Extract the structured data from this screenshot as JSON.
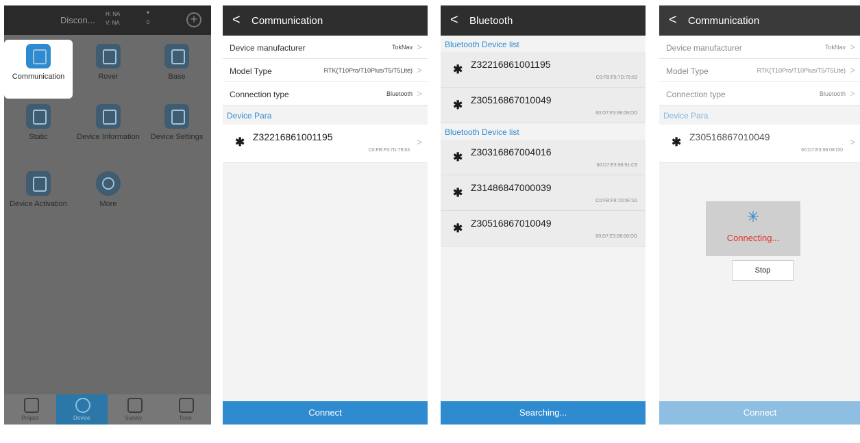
{
  "home": {
    "status": {
      "conn": "Discon...",
      "h": "H: NA",
      "v": "V: NA",
      "sats": "0"
    },
    "grid": [
      {
        "label": "Communication",
        "icon": "communication-icon"
      },
      {
        "label": "Rover",
        "icon": "rover-icon"
      },
      {
        "label": "Base",
        "icon": "base-icon"
      },
      {
        "label": "Static",
        "icon": "static-icon"
      },
      {
        "label": "Device Information",
        "icon": "device-info-icon"
      },
      {
        "label": "Device Settings",
        "icon": "device-settings-icon"
      },
      {
        "label": "Device Activation",
        "icon": "device-activation-icon"
      },
      {
        "label": "More",
        "icon": "more-icon"
      }
    ],
    "nav": [
      "Project",
      "Device",
      "Survey",
      "Tools"
    ]
  },
  "comm": {
    "title": "Communication",
    "rows": [
      {
        "label": "Device manufacturer",
        "value": "TokNav"
      },
      {
        "label": "Model Type",
        "value": "RTK(T10Pro/T10Plus/T5/T5Lite)"
      },
      {
        "label": "Connection type",
        "value": "Bluetooth"
      }
    ],
    "section": "Device Para",
    "device": {
      "name": "Z32216861001195",
      "mac": "C0:FB:F9:7D:79:63"
    },
    "connect": "Connect"
  },
  "bt": {
    "title": "Bluetooth",
    "list1_title": "Bluetooth Device list",
    "list1": [
      {
        "name": "Z32216861001195",
        "mac": "C0:FB:F9:7D:79:63"
      },
      {
        "name": "Z30516867010049",
        "mac": "60:D7:E3:98:08:DD"
      }
    ],
    "list2_title": "Bluetooth Device list",
    "list2": [
      {
        "name": "Z30316867004016",
        "mac": "60:D7:E3:98:91:C9"
      },
      {
        "name": "Z31486847000039",
        "mac": "C0:FB:F9:7D:6F:91"
      },
      {
        "name": "Z30516867010049",
        "mac": "60:D7:E3:98:08:DD"
      }
    ],
    "searching": "Searching..."
  },
  "comm2": {
    "title": "Communication",
    "rows": [
      {
        "label": "Device manufacturer",
        "value": "TokNav"
      },
      {
        "label": "Model Type",
        "value": "RTK(T10Pro/T10Plus/T5/T5Lite)"
      },
      {
        "label": "Connection type",
        "value": "Bluetooth"
      }
    ],
    "section": "Device Para",
    "device": {
      "name": "Z30516867010049",
      "mac": "60:D7:E3:98:08:DD"
    },
    "connecting": "Connecting...",
    "stop": "Stop",
    "connect": "Connect"
  }
}
